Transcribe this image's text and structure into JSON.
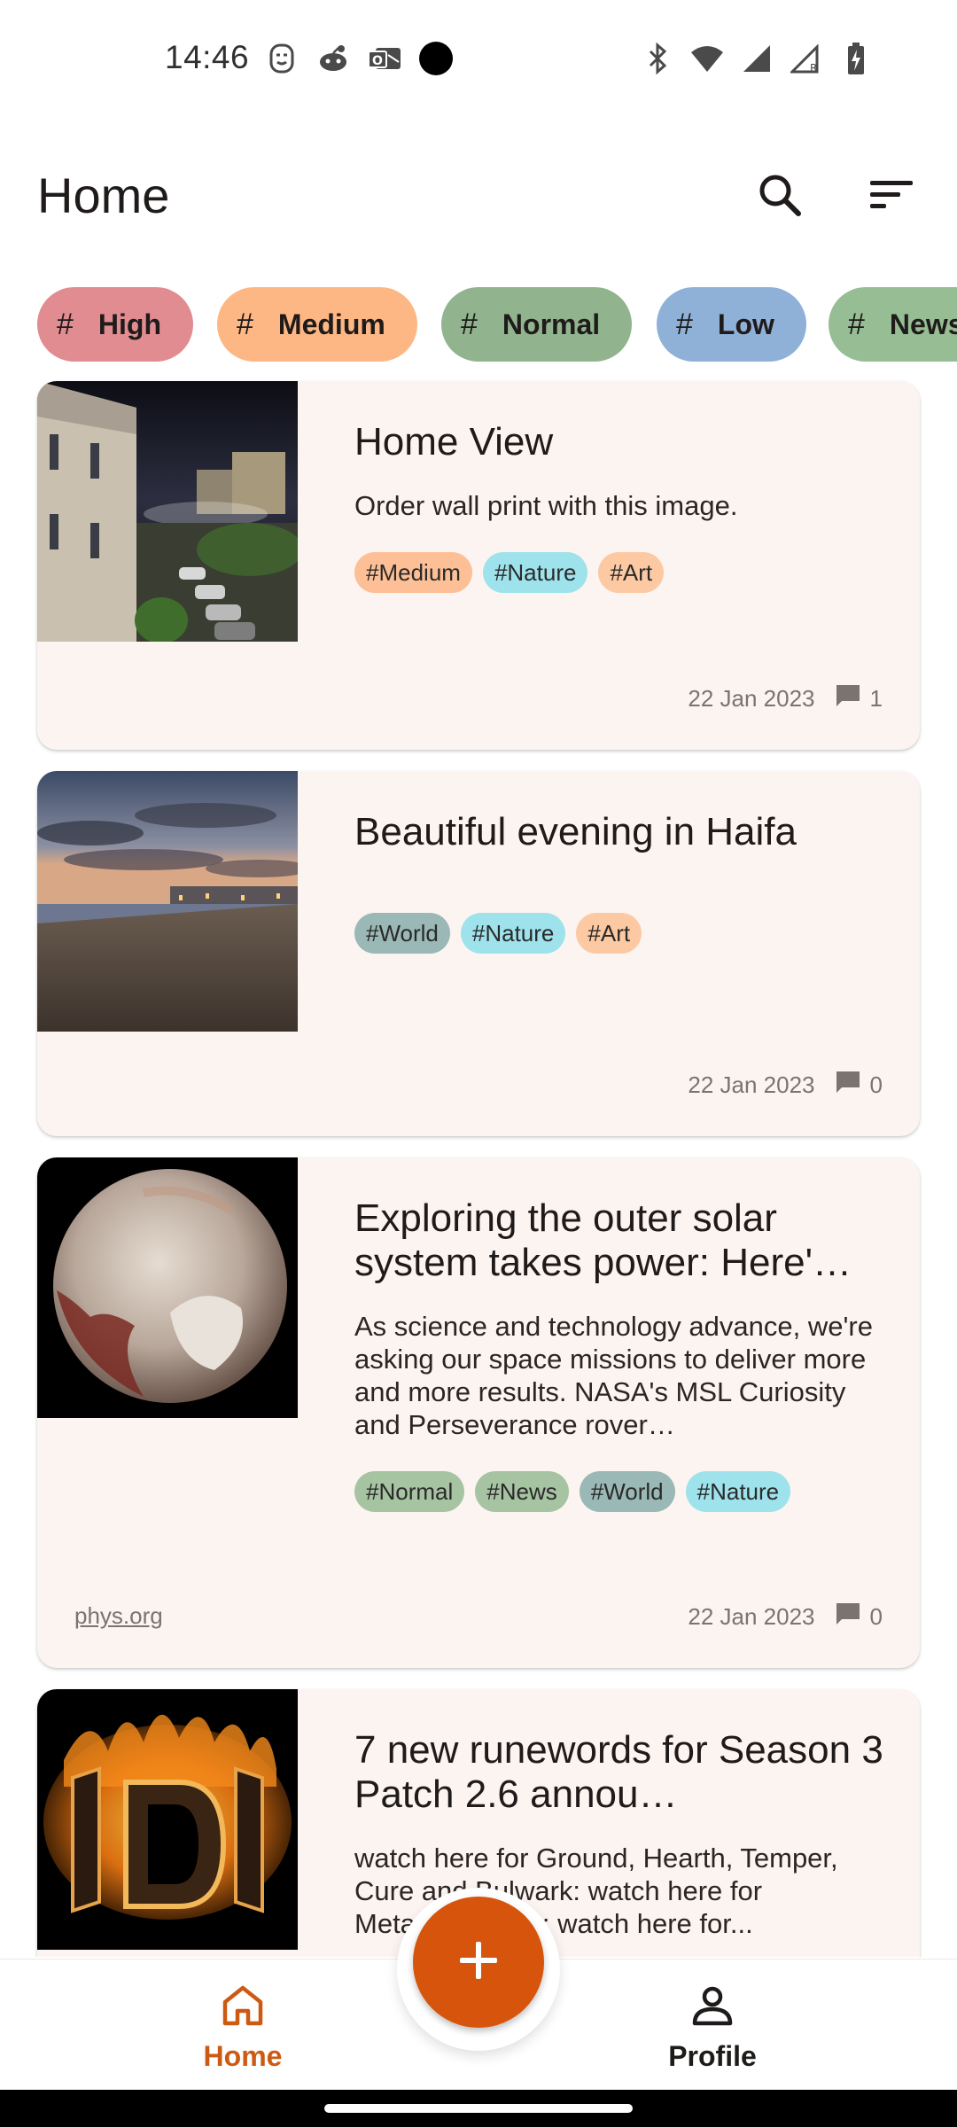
{
  "status_bar": {
    "time": "14:46",
    "left_icons": [
      "emoji-face-icon",
      "reddit-icon",
      "outlook-icon",
      "camera-dot-icon"
    ],
    "right_icons": [
      "bluetooth-icon",
      "wifi-icon",
      "signal-icon",
      "signal-roaming-icon",
      "battery-charging-icon"
    ]
  },
  "app_bar": {
    "title": "Home",
    "actions": [
      "search-icon",
      "sort-icon"
    ]
  },
  "filter_chips": [
    {
      "label": "High",
      "color": "#e08c91"
    },
    {
      "label": "Medium",
      "color": "#fdb784"
    },
    {
      "label": "Normal",
      "color": "#91b48f"
    },
    {
      "label": "Low",
      "color": "#8fb1d8"
    },
    {
      "label": "News",
      "color": "#96bd94"
    }
  ],
  "posts": [
    {
      "title": "Home View",
      "description": "Order wall print with this image.",
      "tags": [
        {
          "label": "#Medium",
          "color": "#fdbf96"
        },
        {
          "label": "#Nature",
          "color": "#9ee3ec"
        },
        {
          "label": "#Art",
          "color": "#fdc9a2"
        }
      ],
      "source": "",
      "date": "22 Jan 2023",
      "comments": "1"
    },
    {
      "title": "Beautiful evening in Haifa",
      "description": "",
      "tags": [
        {
          "label": "#World",
          "color": "#9ab8b5"
        },
        {
          "label": "#Nature",
          "color": "#9ee3ec"
        },
        {
          "label": "#Art",
          "color": "#fdc9a2"
        }
      ],
      "source": "",
      "date": "22 Jan 2023",
      "comments": "0"
    },
    {
      "title": "Exploring the outer solar system takes power: Here'…",
      "description": "As science and technology advance, we're asking our space missions to deliver more and more results. NASA's MSL Curiosity and Perseverance rover…",
      "tags": [
        {
          "label": "#Normal",
          "color": "#a6c4a2"
        },
        {
          "label": "#News",
          "color": "#a6c4a2"
        },
        {
          "label": "#World",
          "color": "#9ab8b5"
        },
        {
          "label": "#Nature",
          "color": "#9ee3ec"
        }
      ],
      "source": "phys.org",
      "date": "22 Jan 2023",
      "comments": "0"
    },
    {
      "title": "7 new runewords for Season 3 Patch 2.6 annou…",
      "description": "watch here for Ground, Hearth, Temper, Cure and Bulwark: watch here for Metamorphosis: watch here for...",
      "tags": [],
      "source": "",
      "date": "",
      "comments": ""
    }
  ],
  "fab": {
    "icon": "plus-icon"
  },
  "bottom_nav": {
    "items": [
      {
        "label": "Home",
        "icon": "home-icon",
        "active": true
      },
      {
        "label": "Profile",
        "icon": "person-icon",
        "active": false
      }
    ],
    "active_color": "#cc5a12"
  }
}
